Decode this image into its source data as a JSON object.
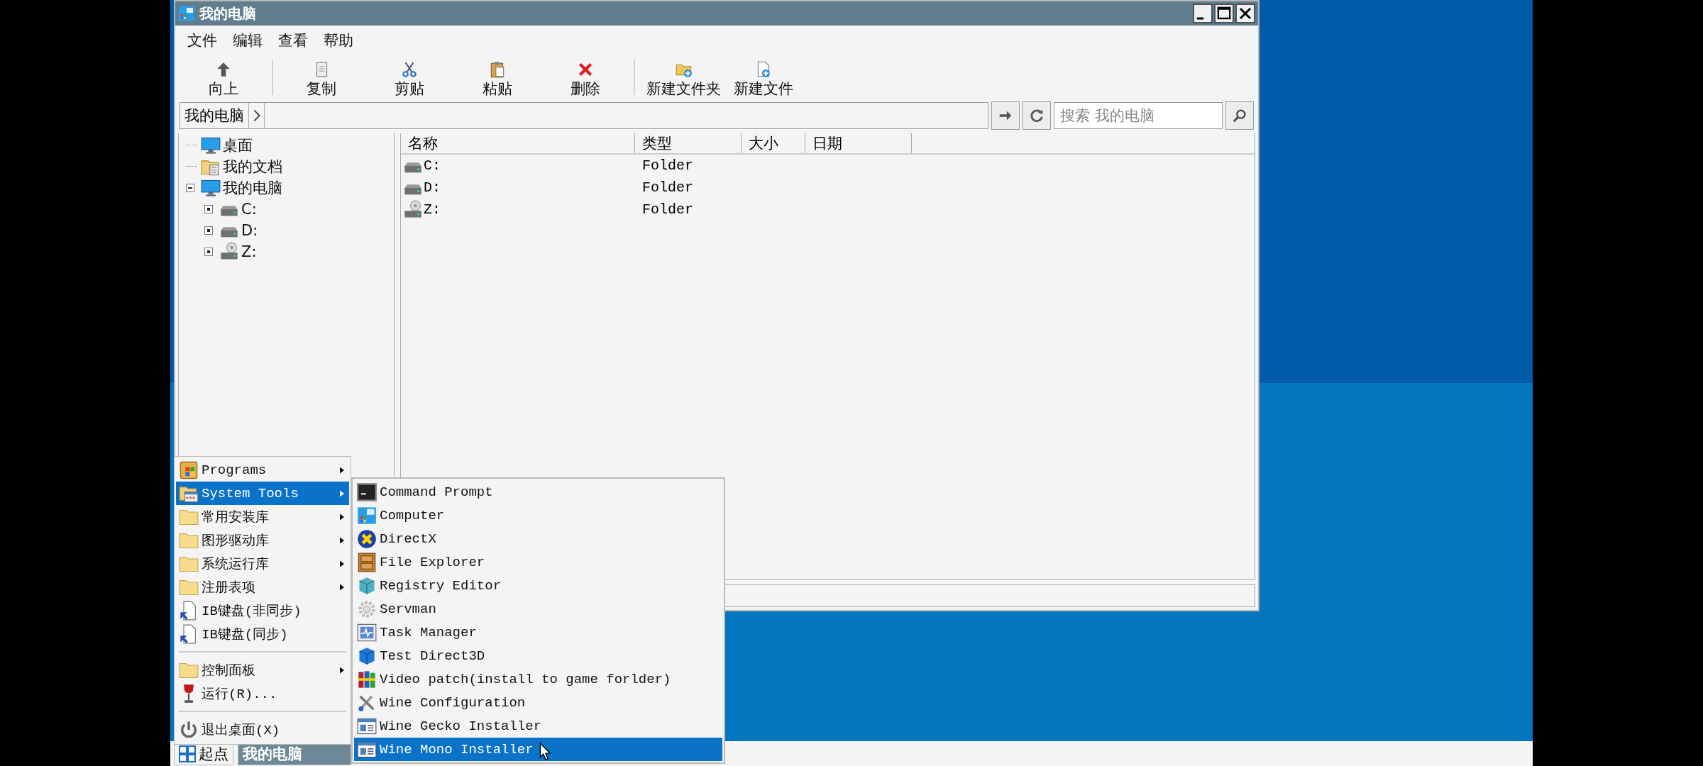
{
  "window": {
    "title": "我的电脑"
  },
  "menu_bar": [
    "文件",
    "编辑",
    "查看",
    "帮助"
  ],
  "toolbar": [
    {
      "kind": "up",
      "label": "向上"
    },
    {
      "kind": "separator"
    },
    {
      "kind": "copy",
      "label": "复制"
    },
    {
      "kind": "cut",
      "label": "剪贴"
    },
    {
      "kind": "paste",
      "label": "粘贴"
    },
    {
      "kind": "delete",
      "label": "删除"
    },
    {
      "kind": "separator"
    },
    {
      "kind": "new_folder",
      "label": "新建文件夹"
    },
    {
      "kind": "new_file",
      "label": "新建文件"
    }
  ],
  "address_bar": {
    "crumb": "我的电脑",
    "search_placeholder": "搜索 我的电脑"
  },
  "tree": [
    {
      "label": "桌面",
      "kind": "monitor"
    },
    {
      "label": "我的文档",
      "kind": "documents"
    },
    {
      "label": "我的电脑",
      "kind": "monitor",
      "expanded": true,
      "children": [
        {
          "label": "C:",
          "kind": "drive",
          "expanded": false
        },
        {
          "label": "D:",
          "kind": "drive",
          "expanded": false
        },
        {
          "label": "Z:",
          "kind": "disc",
          "expanded": false
        }
      ]
    }
  ],
  "file_list": {
    "columns": [
      "名称",
      "类型",
      "大小",
      "日期"
    ],
    "rows": [
      {
        "name": "C:",
        "type": "Folder",
        "kind": "drive"
      },
      {
        "name": "D:",
        "type": "Folder",
        "kind": "drive"
      },
      {
        "name": "Z:",
        "type": "Folder",
        "kind": "disc"
      }
    ]
  },
  "start_menu": [
    {
      "label": "Programs",
      "kind": "programs",
      "submenu": true,
      "selected": false
    },
    {
      "label": "System Tools",
      "kind": "system_tools",
      "submenu": true,
      "selected": true
    },
    {
      "label": "常用安装库",
      "kind": "folder",
      "submenu": true,
      "selected": false
    },
    {
      "label": "图形驱动库",
      "kind": "folder",
      "submenu": true,
      "selected": false
    },
    {
      "label": "系统运行库",
      "kind": "folder",
      "submenu": true,
      "selected": false
    },
    {
      "label": "注册表项",
      "kind": "folder",
      "submenu": true,
      "selected": false
    },
    {
      "label": "IB键盘(非同步)",
      "kind": "shortcut",
      "submenu": false,
      "selected": false
    },
    {
      "label": "IB键盘(同步)",
      "kind": "shortcut",
      "submenu": false,
      "selected": false
    },
    {
      "kind": "separator"
    },
    {
      "label": "控制面板",
      "kind": "folder",
      "submenu": true,
      "selected": false
    },
    {
      "label": "运行(R)...",
      "kind": "run",
      "submenu": false,
      "selected": false
    },
    {
      "kind": "separator"
    },
    {
      "label": "退出桌面(X)",
      "kind": "power",
      "submenu": false,
      "selected": false
    }
  ],
  "system_tools_menu": [
    {
      "label": "Command Prompt",
      "kind": "terminal",
      "selected": false
    },
    {
      "label": "Computer",
      "kind": "computer",
      "selected": false
    },
    {
      "label": "DirectX",
      "kind": "directx",
      "selected": false
    },
    {
      "label": "File Explorer",
      "kind": "cabinet",
      "selected": false
    },
    {
      "label": "Registry Editor",
      "kind": "registry",
      "selected": false
    },
    {
      "label": "Servman",
      "kind": "gear",
      "selected": false
    },
    {
      "label": "Task Manager",
      "kind": "taskmgr",
      "selected": false
    },
    {
      "label": "Test Direct3D",
      "kind": "cube",
      "selected": false
    },
    {
      "label": "Video patch(install to game forlder)",
      "kind": "archive",
      "selected": false
    },
    {
      "label": "Wine Configuration",
      "kind": "tools",
      "selected": false
    },
    {
      "label": "Wine Gecko Installer",
      "kind": "app_window",
      "selected": false
    },
    {
      "label": "Wine Mono Installer",
      "kind": "app_window",
      "selected": true
    }
  ],
  "taskbar": {
    "start_label": "起点",
    "tasks": [
      {
        "label": "我的电脑",
        "selected": true
      }
    ]
  }
}
